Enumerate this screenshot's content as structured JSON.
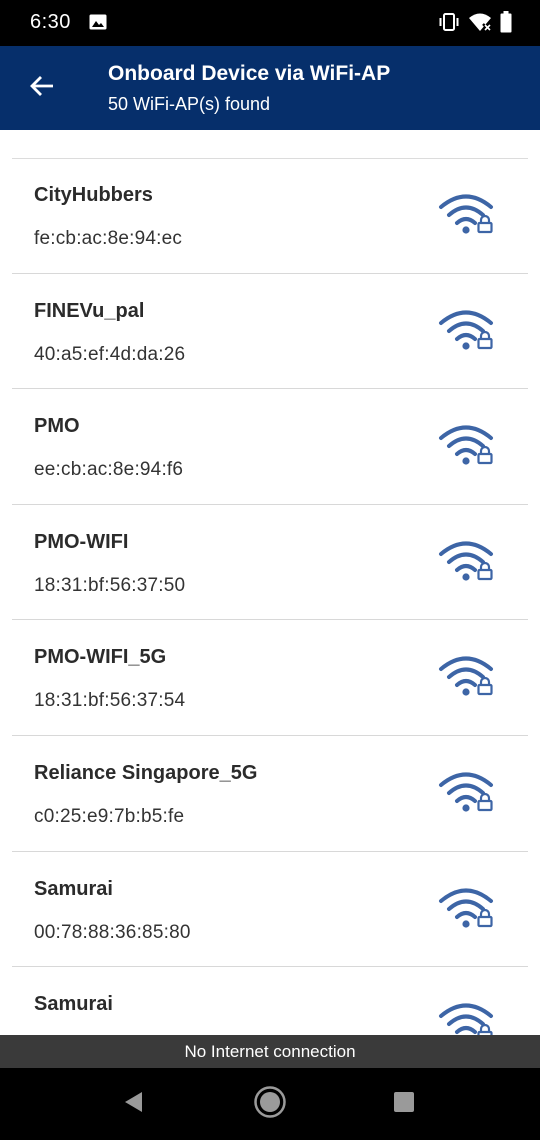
{
  "status_bar": {
    "time": "6:30",
    "icons": [
      "gallery-icon",
      "vibrate-icon",
      "wifi-off-icon",
      "battery-icon"
    ]
  },
  "app_bar": {
    "back_icon": "arrow-back-icon",
    "title": "Onboard Device via WiFi-AP",
    "subtitle": "50 WiFi-AP(s) found"
  },
  "access_points": [
    {
      "name": "CityHubbers",
      "mac": "fe:cb:ac:8e:94:ec",
      "icon": "wifi-locked-icon"
    },
    {
      "name": "FINEVu_pal",
      "mac": "40:a5:ef:4d:da:26",
      "icon": "wifi-locked-icon"
    },
    {
      "name": "PMO",
      "mac": "ee:cb:ac:8e:94:f6",
      "icon": "wifi-locked-icon"
    },
    {
      "name": "PMO-WIFI",
      "mac": "18:31:bf:56:37:50",
      "icon": "wifi-locked-icon"
    },
    {
      "name": "PMO-WIFI_5G",
      "mac": "18:31:bf:56:37:54",
      "icon": "wifi-locked-icon"
    },
    {
      "name": "Reliance Singapore_5G",
      "mac": "c0:25:e9:7b:b5:fe",
      "icon": "wifi-locked-icon"
    },
    {
      "name": "Samurai",
      "mac": "00:78:88:36:85:80",
      "icon": "wifi-locked-icon"
    },
    {
      "name": "Samurai",
      "mac": "",
      "icon": "wifi-locked-icon"
    }
  ],
  "snackbar": {
    "message": "No Internet connection"
  },
  "nav_bar": {
    "buttons": [
      "back-triangle-icon",
      "home-circle-icon",
      "recents-square-icon"
    ]
  },
  "colors": {
    "app_bar": "#062f6b",
    "wifi_icon": "#3d65a6",
    "snackbar": "#3a3a3a"
  }
}
